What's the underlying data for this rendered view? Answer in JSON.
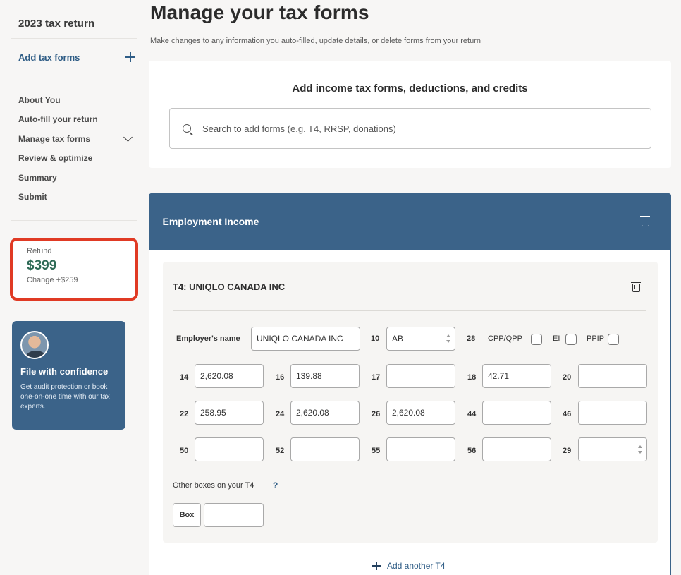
{
  "sidebar": {
    "title": "2023 tax return",
    "add_forms_label": "Add tax forms",
    "nav": [
      "About You",
      "Auto-fill your return",
      "Manage tax forms",
      "Review & optimize",
      "Summary",
      "Submit"
    ],
    "refund": {
      "label": "Refund",
      "amount": "$399",
      "change": "Change +$259"
    },
    "promo": {
      "title": "File with confidence",
      "text": "Get audit protection or book one-on-one time with our tax experts."
    }
  },
  "main": {
    "title": "Manage your tax forms",
    "subtitle": "Make changes to any information you auto-filled, update details, or delete forms from your return",
    "add_card": {
      "title": "Add income tax forms, deductions, and credits",
      "search_placeholder": "Search to add forms (e.g. T4, RRSP, donations)"
    },
    "employment": {
      "title": "Employment Income",
      "t4": {
        "title": "T4: UNIQLO CANADA INC",
        "employer_label": "Employer's name",
        "employer_value": "UNIQLO CANADA INC",
        "box10_label": "10",
        "box10_value": "AB",
        "box28_label": "28",
        "checks": [
          "CPP/QPP",
          "EI",
          "PPIP"
        ],
        "rows": [
          [
            {
              "box": "14",
              "value": "2,620.08"
            },
            {
              "box": "16",
              "value": "139.88"
            },
            {
              "box": "17",
              "value": ""
            },
            {
              "box": "18",
              "value": "42.71"
            },
            {
              "box": "20",
              "value": ""
            }
          ],
          [
            {
              "box": "22",
              "value": "258.95"
            },
            {
              "box": "24",
              "value": "2,620.08"
            },
            {
              "box": "26",
              "value": "2,620.08"
            },
            {
              "box": "44",
              "value": ""
            },
            {
              "box": "46",
              "value": ""
            }
          ],
          [
            {
              "box": "50",
              "value": ""
            },
            {
              "box": "52",
              "value": ""
            },
            {
              "box": "55",
              "value": ""
            },
            {
              "box": "56",
              "value": ""
            },
            {
              "box": "29",
              "value": ""
            }
          ]
        ],
        "other_label": "Other boxes on your T4",
        "help_symbol": "?",
        "box_button": "Box"
      },
      "add_another": "Add another T4"
    }
  },
  "colors": {
    "accent": "#3b6389",
    "refund_green": "#2e6a56",
    "highlight": "#e03a24"
  },
  "icons": [
    "plus-icon",
    "chevron-down-icon",
    "search-icon",
    "trash-icon",
    "avatar"
  ]
}
